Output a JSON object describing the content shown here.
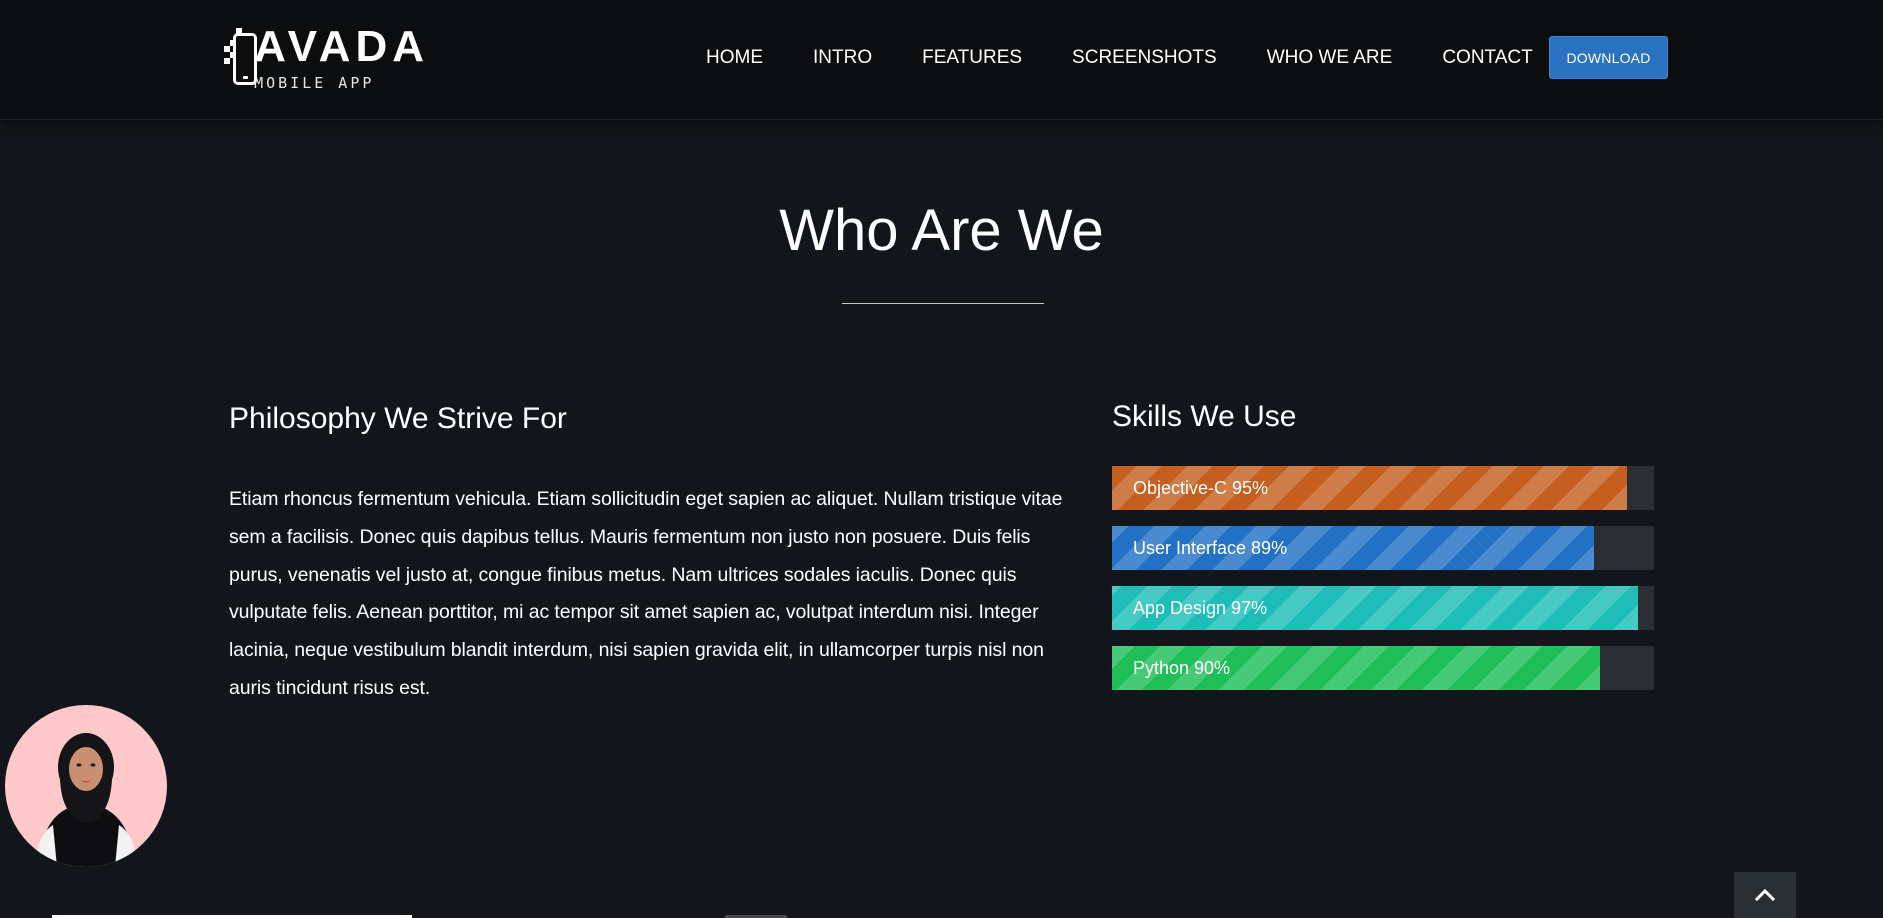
{
  "header": {
    "logo": {
      "title": "AVADA",
      "subtitle": "MOBILE APP",
      "icon": "phone-logo-icon"
    },
    "nav": {
      "items": [
        {
          "label": "HOME"
        },
        {
          "label": "INTRO"
        },
        {
          "label": "FEATURES"
        },
        {
          "label": "SCREENSHOTS"
        },
        {
          "label": "WHO WE ARE"
        },
        {
          "label": "CONTACT"
        }
      ]
    },
    "download_label": "DOWNLOAD"
  },
  "section": {
    "title": "Who Are We"
  },
  "philosophy": {
    "heading": "Philosophy We Strive For",
    "paragraph": "Etiam rhoncus fermentum vehicula. Etiam sollicitudin eget sapien ac aliquet. Nullam tristique vitae sem a facilisis. Donec quis dapibus tellus. Mauris fermentum non justo non posuere. Duis felis purus, venenatis vel justo at, congue finibus metus. Nam ultrices sodales iaculis. Donec quis vulputate felis. Aenean porttitor, mi ac tempor sit amet sapien ac, volutpat interdum nisi. Integer lacinia, neque vestibulum blandit interdum, nisi sapien gravida elit, in ullamcorper turpis nisl non auris tincidunt risus est."
  },
  "skills": {
    "heading": "Skills We Use",
    "items": [
      {
        "label": "Objective-C 95%",
        "percent": 95,
        "color": "#c45f20"
      },
      {
        "label": "User Interface 89%",
        "percent": 89,
        "color": "#2271c4"
      },
      {
        "label": "App Design 97%",
        "percent": 97,
        "color": "#1fbdb8"
      },
      {
        "label": "Python 90%",
        "percent": 90,
        "color": "#1fbe58"
      }
    ]
  },
  "widgets": {
    "avatar_icon": "person-avatar",
    "back_to_top_icon": "chevron-up-icon"
  },
  "colors": {
    "page_background": "#12161a",
    "header_background": "#0b0d0f",
    "accent": "#2a72c2",
    "text": "#ffffff",
    "bar_track": "#2a2e32",
    "avatar_background": "#ffc9cc"
  }
}
